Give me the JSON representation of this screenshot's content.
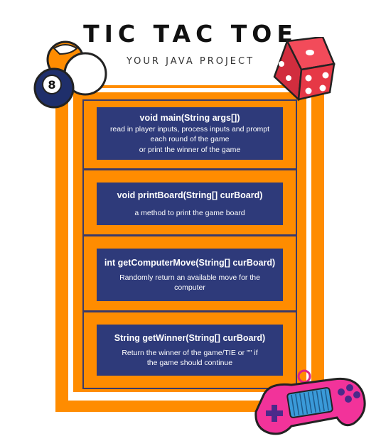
{
  "header": {
    "title": "TIC TAC TOE",
    "subtitle": "YOUR JAVA PROJECT"
  },
  "methods": [
    {
      "signature": "void main(String args[])",
      "description": "read in player inputs, process inputs and prompt\neach round of the game\nor print the winner of the game"
    },
    {
      "signature": "void printBoard(String[] curBoard)",
      "description": "a method to print the game board"
    },
    {
      "signature": "int getComputerMove(String[] curBoard)",
      "description": "Randomly return an available move for the\ncomputer"
    },
    {
      "signature": "String getWinner(String[] curBoard)",
      "description": "Return the winner of the game/TIE or \"\" if\nthe game should continue"
    }
  ],
  "decorations": {
    "balls": {
      "icon": "billiard-balls-icon",
      "ball_number": "8"
    },
    "dice": {
      "icon": "dice-icon"
    },
    "controller": {
      "icon": "game-controller-icon"
    }
  },
  "colors": {
    "frame_orange": "#ff8c00",
    "card_navy": "#2e3a7a",
    "line": "#3a3a6a"
  }
}
